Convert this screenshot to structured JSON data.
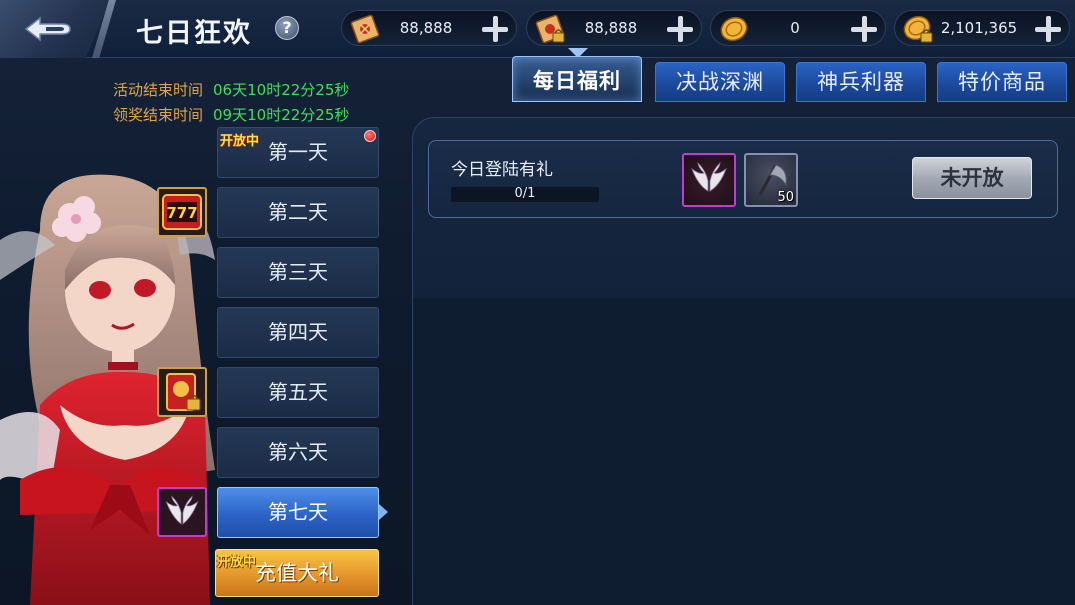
{
  "header": {
    "title": "七日狂欢",
    "help_icon": "question-mark-icon"
  },
  "resources": [
    {
      "icon": "scroll-icon",
      "value": "88,888"
    },
    {
      "icon": "locked-scroll-icon",
      "value": "88,888"
    },
    {
      "icon": "coin-icon",
      "value": "0"
    },
    {
      "icon": "locked-coin-icon",
      "value": "2,101,365"
    }
  ],
  "timers": {
    "activity_end_label": "活动结束时间",
    "activity_end_value": "06天10时22分25秒",
    "reward_end_label": "领奖结束时间",
    "reward_end_value": "09天10时22分25秒"
  },
  "tabs": [
    {
      "label": "每日福利",
      "active": true
    },
    {
      "label": "决战深渊",
      "active": false
    },
    {
      "label": "神兵利器",
      "active": false
    },
    {
      "label": "特价商品",
      "active": false
    }
  ],
  "days": [
    {
      "label": "第一天",
      "tag": "开放中",
      "red_dot": true
    },
    {
      "label": "第二天",
      "badge": "slot-777-icon"
    },
    {
      "label": "第三天"
    },
    {
      "label": "第四天"
    },
    {
      "label": "第五天",
      "badge": "locked-card-icon"
    },
    {
      "label": "第六天"
    },
    {
      "label": "第七天",
      "badge": "wings-icon",
      "selected": true
    }
  ],
  "recharge": {
    "label": "充值大礼",
    "tag": "开放中"
  },
  "task": {
    "name": "今日登陆有礼",
    "progress_text": "0/1",
    "progress": 0,
    "rewards": [
      {
        "icon": "wings-icon",
        "qty": ""
      },
      {
        "icon": "scythe-icon",
        "qty": "50"
      }
    ],
    "status_button": "未开放"
  },
  "colors": {
    "timer_label": "#e0a54a",
    "timer_value": "#3ee05a",
    "tab_active_border": "#9ec3f5",
    "day_selected": "#2c63c6",
    "recharge": "#e5962a"
  }
}
